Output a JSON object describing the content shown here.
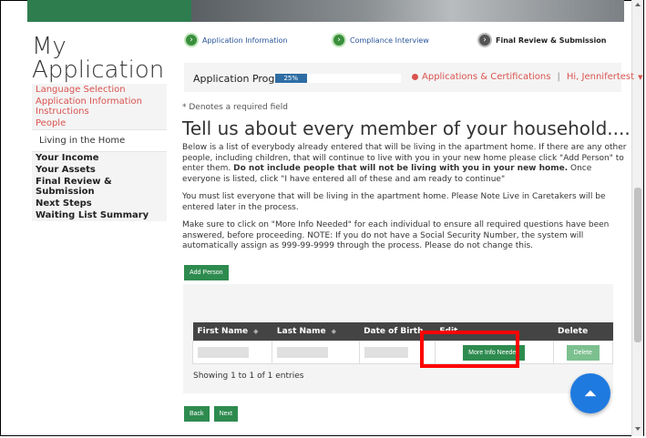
{
  "sidebar": {
    "title_line1": "My",
    "title_line2": "Application",
    "items": [
      {
        "label": "Language Selection",
        "style": "red"
      },
      {
        "label": "Application Information Instructions",
        "style": "red"
      },
      {
        "label": "People",
        "style": "red"
      },
      {
        "label": "Living in the Home",
        "style": "active"
      },
      {
        "label": "Your Income",
        "style": "dark"
      },
      {
        "label": "Your Assets",
        "style": "dark"
      },
      {
        "label": "Final Review & Submission",
        "style": "dark"
      },
      {
        "label": "Next Steps",
        "style": "dark"
      },
      {
        "label": "Waiting List Summary",
        "style": "dark"
      }
    ]
  },
  "steps": [
    {
      "label": "Application Information",
      "icon": "chevron-right-icon"
    },
    {
      "label": "Compliance Interview",
      "icon": "chevron-right-icon"
    },
    {
      "label": "Final Review & Submission",
      "icon": "chevron-right-icon"
    }
  ],
  "progress": {
    "label": "Application Progress",
    "percent_text": "25%",
    "value": 0.25,
    "certifications": "Applications & Certifications",
    "user": "Hi, Jennifertest"
  },
  "content": {
    "required_note": "* Denotes a required field",
    "heading": "Tell us about every member of your household....",
    "para1_a": "Below is a list of everybody already entered that will be living in the apartment home. If there are any other people, including children, that will continue to live with you in your new home please click \"Add Person\" to enter them. ",
    "para1_b": "Do not include people that will not be living with you in your new home.",
    "para1_c": " Once everyone is listed, click \"I have entered all of these and am ready to continue\"",
    "para2": "You must list everyone that will be living in the apartment home.  Please Note Live in Caretakers will be entered later in the process.",
    "para3": "Make sure to click on \"More Info Needed\" for each individual to ensure all required questions have been answered, before proceeding.  NOTE:  If you do not have a Social Security Number, the system will automatically assign as 999-99-9999 through the process.  Please do not change this."
  },
  "buttons": {
    "add_person": "Add Person",
    "more_info": "More Info Needed",
    "delete": "Delete",
    "back": "Back",
    "next": "Next"
  },
  "table": {
    "headers": [
      "First Name",
      "Last Name",
      "Date of Birth",
      "Edit",
      "Delete"
    ],
    "showing": "Showing 1 to 1 of 1 entries"
  },
  "colors": {
    "accent_green": "#2e8b4f",
    "nav_red": "#d9534f",
    "highlight_red": "#ff0000",
    "progress_blue": "#2e6da4"
  }
}
